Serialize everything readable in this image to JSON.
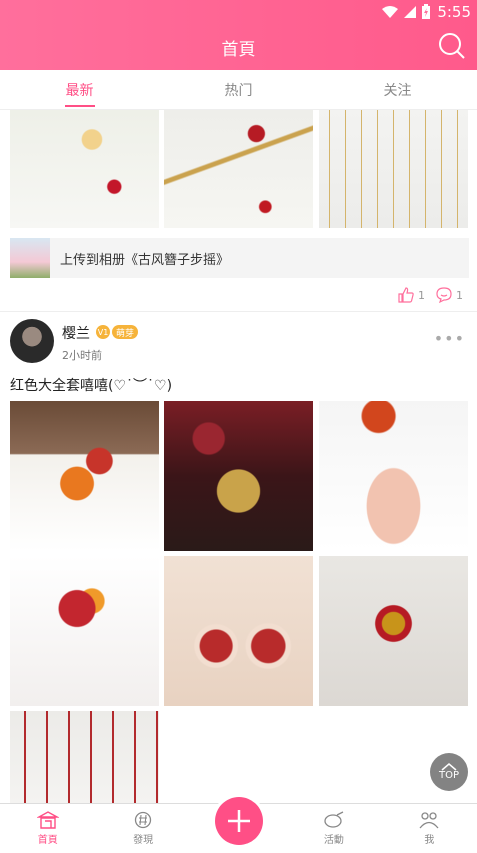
{
  "status_bar": {
    "time": "5:55"
  },
  "header": {
    "title": "首頁"
  },
  "tabs": [
    {
      "label": "最新",
      "active": true
    },
    {
      "label": "热门",
      "active": false
    },
    {
      "label": "关注",
      "active": false
    }
  ],
  "first_post": {
    "album_text": "上传到相册《古风簪子步摇》",
    "like_count": "1",
    "comment_count": "1"
  },
  "post": {
    "username": "樱兰",
    "badge_level": "V1",
    "badge_label": "萌芽",
    "time": "2小时前",
    "text": "红色大全套嘻嘻(♡˙︶˙♡)"
  },
  "top_button": {
    "label": "TOP"
  },
  "bottom_nav": [
    {
      "label": "首頁",
      "icon": "home-icon",
      "active": true
    },
    {
      "label": "發現",
      "icon": "discover-icon",
      "active": false
    },
    {
      "label": "活動",
      "icon": "activity-icon",
      "active": false
    },
    {
      "label": "我",
      "icon": "profile-icon",
      "active": false
    }
  ],
  "colors": {
    "accent": "#ff4f86",
    "header_start": "#ff6f9c",
    "header_end": "#ff5a8b"
  }
}
